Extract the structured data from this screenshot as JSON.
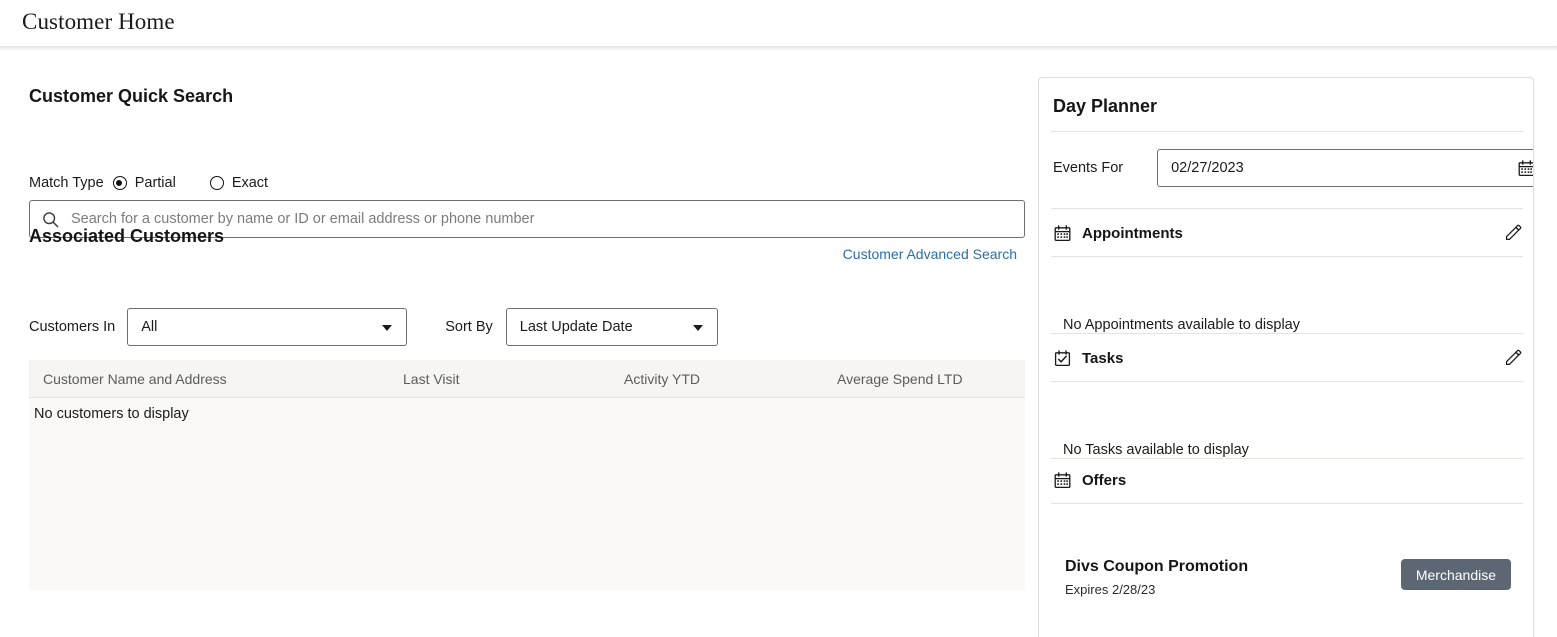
{
  "header": {
    "title": "Customer Home"
  },
  "quick_search": {
    "title": "Customer Quick Search",
    "match_type_label": "Match Type",
    "options": [
      {
        "label": "Partial",
        "selected": true
      },
      {
        "label": "Exact",
        "selected": false
      }
    ],
    "search_placeholder": "Search for a customer by name or ID or email address or phone number",
    "search_value": "",
    "search_icon": "search-icon",
    "advanced_link": "Customer Advanced Search"
  },
  "associated_customers": {
    "title": "Associated Customers",
    "customers_in_label": "Customers In",
    "customers_in_value": "All",
    "sort_by_label": "Sort By",
    "sort_by_value": "Last Update Date",
    "columns": [
      "Customer Name and Address",
      "Last Visit",
      "Activity YTD",
      "Average Spend LTD"
    ],
    "empty_message": "No customers to display"
  },
  "day_planner": {
    "title": "Day Planner",
    "events_for_label": "Events For",
    "events_for_value": "02/27/2023",
    "calendar_icon": "calendar-icon",
    "sections": [
      {
        "name": "Appointments",
        "icon": "calendar-icon",
        "edit_icon": "pencil-icon",
        "empty_message": "No Appointments available to display"
      },
      {
        "name": "Tasks",
        "icon": "task-checklist-icon",
        "edit_icon": "pencil-icon",
        "empty_message": "No Tasks available to display"
      },
      {
        "name": "Offers",
        "icon": "calendar-icon"
      }
    ],
    "offers": [
      {
        "name": "Divs Coupon Promotion",
        "expires": "Expires 2/28/23",
        "tag": "Merchandise"
      }
    ]
  },
  "colors": {
    "link": "#2e6ea6",
    "tag_background": "#5c6773",
    "table_header_background": "#f6f5f3",
    "table_body_background": "#faf9f8"
  }
}
